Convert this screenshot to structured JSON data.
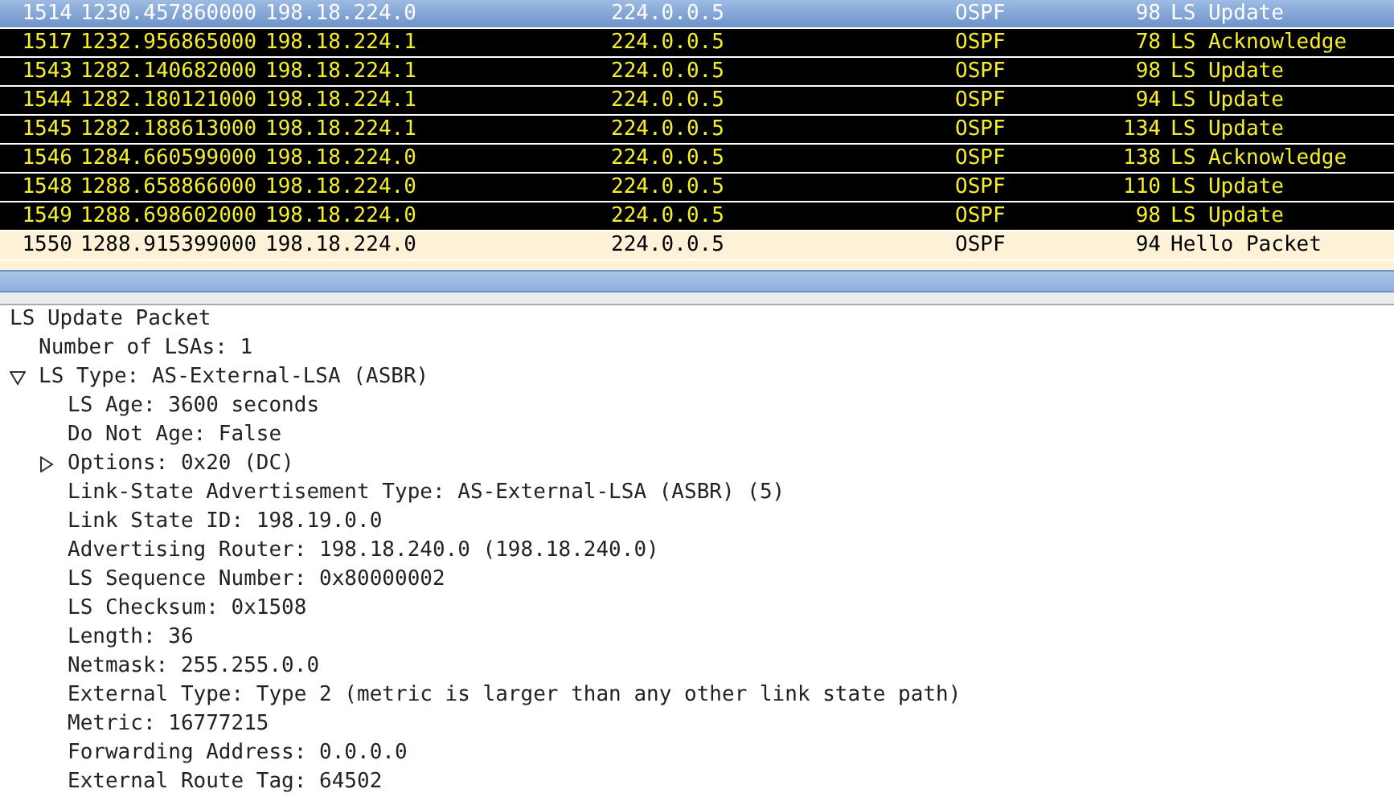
{
  "packets": [
    {
      "no": "1514",
      "time": "1230.457860000",
      "source": "198.18.224.0",
      "destination": "224.0.0.5",
      "protocol": "OSPF",
      "length": "98",
      "info": "LS Update",
      "selected": true
    },
    {
      "no": "1517",
      "time": "1232.956865000",
      "source": "198.18.224.1",
      "destination": "224.0.0.5",
      "protocol": "OSPF",
      "length": "78",
      "info": "LS Acknowledge",
      "selected": false,
      "kind": "ls"
    },
    {
      "no": "1543",
      "time": "1282.140682000",
      "source": "198.18.224.1",
      "destination": "224.0.0.5",
      "protocol": "OSPF",
      "length": "98",
      "info": "LS Update",
      "selected": false,
      "kind": "ls"
    },
    {
      "no": "1544",
      "time": "1282.180121000",
      "source": "198.18.224.1",
      "destination": "224.0.0.5",
      "protocol": "OSPF",
      "length": "94",
      "info": "LS Update",
      "selected": false,
      "kind": "ls"
    },
    {
      "no": "1545",
      "time": "1282.188613000",
      "source": "198.18.224.1",
      "destination": "224.0.0.5",
      "protocol": "OSPF",
      "length": "134",
      "info": "LS Update",
      "selected": false,
      "kind": "ls"
    },
    {
      "no": "1546",
      "time": "1284.660599000",
      "source": "198.18.224.0",
      "destination": "224.0.0.5",
      "protocol": "OSPF",
      "length": "138",
      "info": "LS Acknowledge",
      "selected": false,
      "kind": "ls"
    },
    {
      "no": "1548",
      "time": "1288.658866000",
      "source": "198.18.224.0",
      "destination": "224.0.0.5",
      "protocol": "OSPF",
      "length": "110",
      "info": "LS Update",
      "selected": false,
      "kind": "ls"
    },
    {
      "no": "1549",
      "time": "1288.698602000",
      "source": "198.18.224.0",
      "destination": "224.0.0.5",
      "protocol": "OSPF",
      "length": "98",
      "info": "LS Update",
      "selected": false,
      "kind": "ls"
    },
    {
      "no": "1550",
      "time": "1288.915399000",
      "source": "198.18.224.0",
      "destination": "224.0.0.5",
      "protocol": "OSPF",
      "length": "94",
      "info": "Hello Packet",
      "selected": false,
      "kind": "hello"
    }
  ],
  "details": [
    {
      "label": "LS Update Packet",
      "children": [
        {
          "label": "Number of LSAs: 1"
        },
        {
          "label": "LS Type: AS-External-LSA (ASBR)",
          "expanded": true,
          "children": [
            {
              "label": "LS Age: 3600 seconds"
            },
            {
              "label": "Do Not Age: False"
            },
            {
              "label": "Options: 0x20 (DC)",
              "expanded": false
            },
            {
              "label": "Link-State Advertisement Type: AS-External-LSA (ASBR) (5)"
            },
            {
              "label": "Link State ID: 198.19.0.0"
            },
            {
              "label": "Advertising Router: 198.18.240.0 (198.18.240.0)"
            },
            {
              "label": "LS Sequence Number: 0x80000002"
            },
            {
              "label": "LS Checksum: 0x1508"
            },
            {
              "label": "Length: 36"
            },
            {
              "label": "Netmask: 255.255.0.0"
            },
            {
              "label": "External Type: Type 2 (metric is larger than any other link state path)"
            },
            {
              "label": "Metric: 16777215"
            },
            {
              "label": "Forwarding Address: 0.0.0.0"
            },
            {
              "label": "External Route Tag: 64502"
            }
          ]
        }
      ]
    }
  ]
}
